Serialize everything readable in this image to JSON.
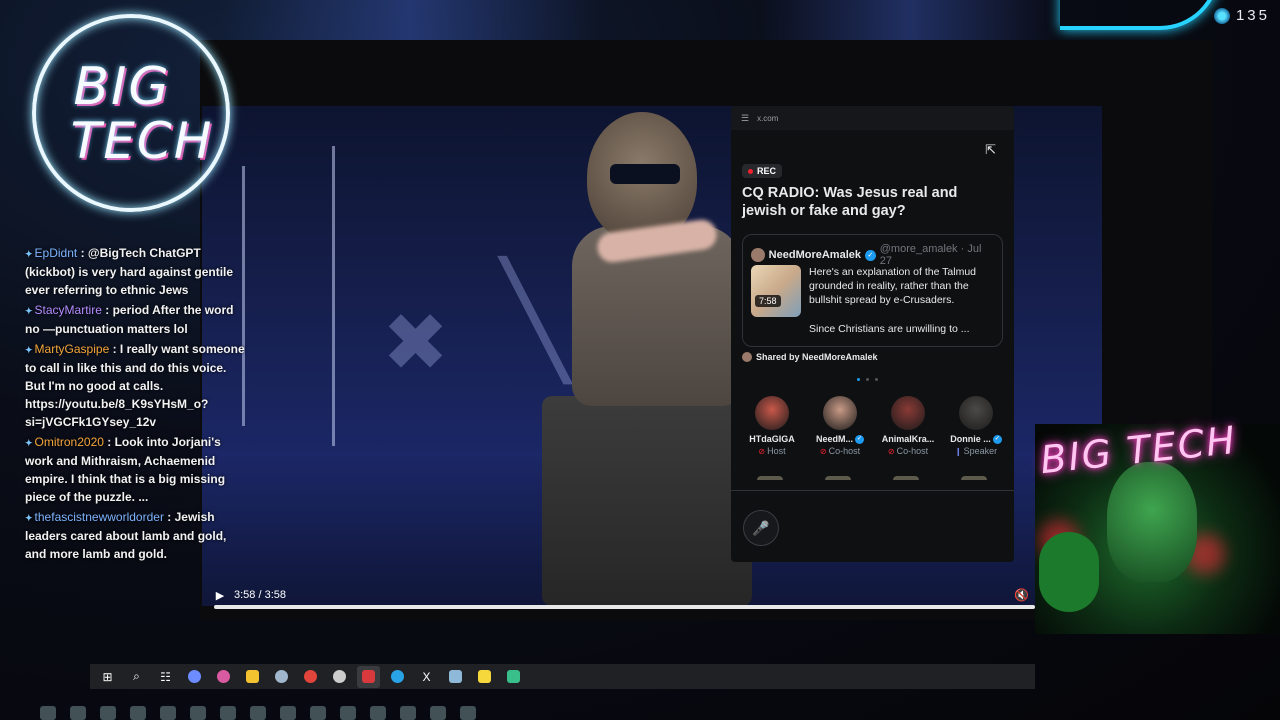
{
  "overlay": {
    "viewer_count": "135",
    "logo_line1": "BIG",
    "logo_line2": "TECH",
    "webcam_logo": "BIG TECH"
  },
  "chat": [
    {
      "user": "EpDidnt",
      "user_color": "#7db4ff",
      "text": ": @BigTech ChatGPT (kickbot) is very hard against gentile ever referring to ethnic Jews"
    },
    {
      "user": "StacyMartire",
      "user_color": "#b68cff",
      "text": ": period After the word no —punctuation matters lol"
    },
    {
      "user": "MartyGaspipe",
      "user_color": "#f4a63a",
      "text": ": I really want someone to call in like this and do this voice. But I'm no good at calls. https://youtu.be/8_K9sYHsM_o?si=jVGCFk1GYsey_12v"
    },
    {
      "user": "Omitron2020",
      "user_color": "#f4a63a",
      "text": ": Look into Jorjani's work and Mithraism, Achaemenid empire. I think that is a big missing piece of the puzzle. ..."
    },
    {
      "user": "thefascistnewworldorder",
      "user_color": "#7db4ff",
      "text": ": Jewish leaders cared about lamb and gold, and more lamb and gold."
    }
  ],
  "video": {
    "time": "3:58 / 3:58",
    "progress": 1.0
  },
  "space_card": {
    "url": "x.com",
    "rec_label": "REC",
    "title": "CQ RADIO: Was Jesus real and jewish or fake and gay?",
    "post": {
      "author": "NeedMoreAmalek",
      "handle": "@more_amalek · Jul 27",
      "duration": "7:58",
      "text": "Here's an explanation of the Talmud grounded in reality, rather than the bullshit spread by e-Crusaders.",
      "text2": "Since Christians are unwilling to ..."
    },
    "shared_by": "Shared by NeedMoreAmalek",
    "speakers": [
      {
        "name": "HTdaGIGA",
        "role": "Host",
        "verified": false,
        "color": "#c9584a"
      },
      {
        "name": "NeedM...",
        "role": "Co-host",
        "verified": true,
        "color": "#c99a86"
      },
      {
        "name": "AnimalKra...",
        "role": "Co-host",
        "verified": false,
        "color": "#8a3a36"
      },
      {
        "name": "Donnie ...",
        "role": "Speaker",
        "verified": true,
        "color": "#4c4a48"
      }
    ]
  },
  "taskbar": {
    "items": [
      {
        "name": "windows-start",
        "glyph": "⊞",
        "color": "#ffffff"
      },
      {
        "name": "search",
        "glyph": "⌕",
        "color": "#ffffff"
      },
      {
        "name": "task-view",
        "glyph": "☷",
        "color": "#ffffff"
      },
      {
        "name": "copilot",
        "glyph": "",
        "color": "#6c8cff"
      },
      {
        "name": "chrome-profile",
        "glyph": "",
        "color": "#d85aa0"
      },
      {
        "name": "file-explorer",
        "glyph": "",
        "color": "#f2c230"
      },
      {
        "name": "steam",
        "glyph": "",
        "color": "#9fb6cc"
      },
      {
        "name": "chrome",
        "glyph": "",
        "color": "#e0443a"
      },
      {
        "name": "obs",
        "glyph": "",
        "color": "#cccccc"
      },
      {
        "name": "media-app",
        "glyph": "",
        "color": "#d8393d"
      },
      {
        "name": "telegram",
        "glyph": "",
        "color": "#2aa3e6"
      },
      {
        "name": "x-app",
        "glyph": "X",
        "color": "#ffffff"
      },
      {
        "name": "notepad",
        "glyph": "",
        "color": "#8fb9d8"
      },
      {
        "name": "sticky-notes",
        "glyph": "",
        "color": "#f5d83c"
      },
      {
        "name": "terminal",
        "glyph": "",
        "color": "#39c08a"
      }
    ]
  }
}
